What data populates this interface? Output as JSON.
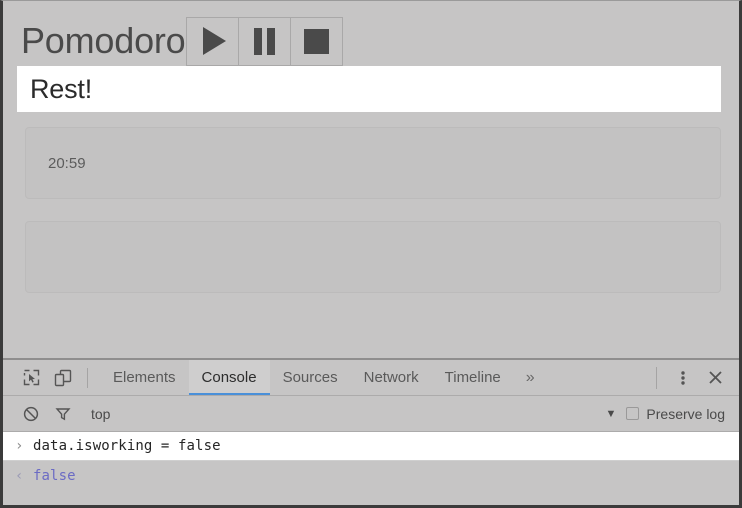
{
  "page": {
    "title": "Pomodoro",
    "controls": [
      {
        "name": "play-button",
        "icon": "play-icon",
        "label": "Play"
      },
      {
        "name": "pause-button",
        "icon": "pause-icon",
        "label": "Pause"
      },
      {
        "name": "stop-button",
        "icon": "stop-icon",
        "label": "Stop"
      }
    ],
    "status_banner": "Rest!",
    "timer": "20:59",
    "secondary_panel": ""
  },
  "devtools": {
    "toolbar": {
      "inspect_icon": "inspect-cursor-icon",
      "device_icon": "device-toggle-icon",
      "tabs": [
        {
          "label": "Elements",
          "active": false
        },
        {
          "label": "Console",
          "active": true
        },
        {
          "label": "Sources",
          "active": false
        },
        {
          "label": "Network",
          "active": false
        },
        {
          "label": "Timeline",
          "active": false
        }
      ],
      "overflow": "»",
      "menu_icon": "kebab-menu-icon",
      "close_icon": "close-icon"
    },
    "filterbar": {
      "clear_icon": "clear-console-icon",
      "filter_icon": "filter-funnel-icon",
      "context": "top",
      "context_caret": "▼",
      "preserve_log_label": "Preserve log",
      "preserve_log_checked": false
    },
    "console": {
      "input_prompt": "›",
      "input_text": "data.isworking = false",
      "output_prompt": "‹",
      "output_text": "false",
      "output_color": "#6b6bc4"
    }
  }
}
